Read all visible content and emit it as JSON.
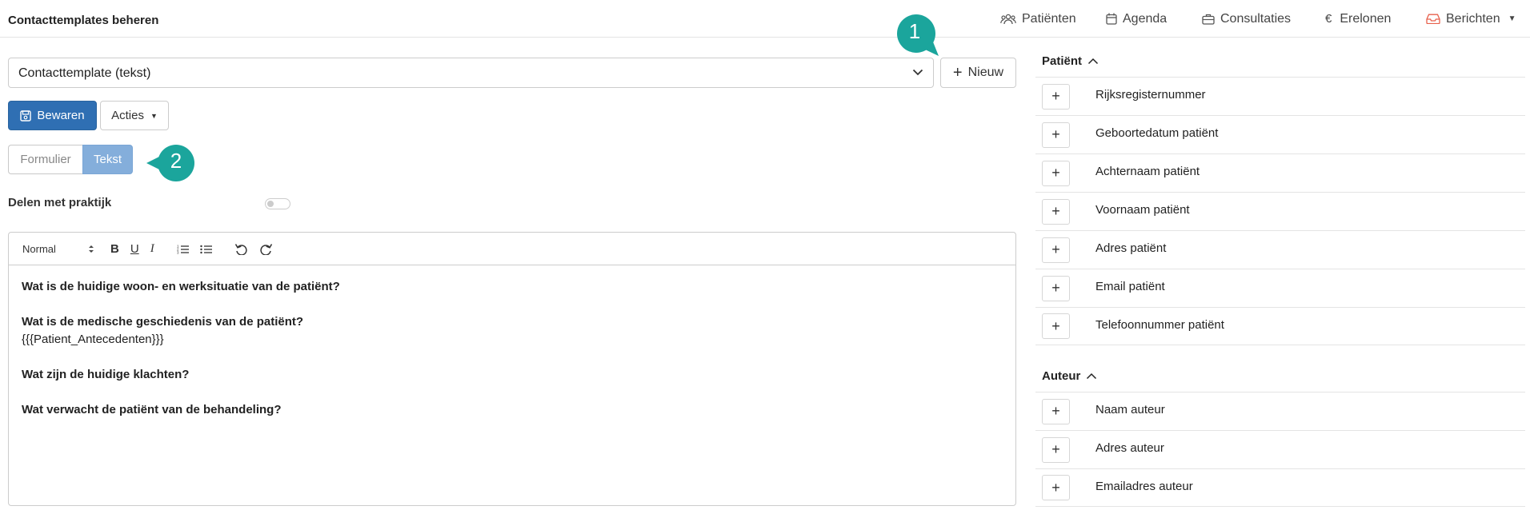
{
  "header": {
    "title": "Contacttemplates beheren",
    "nav": [
      {
        "label": "Patiënten",
        "icon": "users-icon"
      },
      {
        "label": "Agenda",
        "icon": "calendar-icon"
      },
      {
        "label": "Consultaties",
        "icon": "briefcase-icon"
      },
      {
        "label": "Erelonen",
        "icon": "euro-icon"
      },
      {
        "label": "Berichten",
        "icon": "inbox-icon",
        "accent": "#e8604c"
      }
    ]
  },
  "template_select": {
    "value": "Contacttemplate (tekst)"
  },
  "buttons": {
    "new_label": "Nieuw",
    "save_label": "Bewaren",
    "actions_label": "Acties"
  },
  "mode_toggle": {
    "form_label": "Formulier",
    "text_label": "Tekst",
    "active": "Tekst"
  },
  "share": {
    "label": "Delen met praktijk",
    "enabled": false
  },
  "editor": {
    "format_select": "Normal",
    "toolbar_icons": [
      "bold-icon",
      "underline-icon",
      "italic-icon",
      "ordered-list-icon",
      "bullet-list-icon",
      "undo-icon",
      "redo-icon"
    ],
    "bold_label": "B",
    "underline_label": "U",
    "italic_label": "I",
    "lines": [
      "Wat is de huidige woon- en werksituatie van de patiënt?",
      "Wat is de medische geschiedenis van de patiënt?",
      "{{{Patient_Antecedenten}}}",
      "Wat zijn de huidige klachten?",
      "Wat verwacht de patiënt van de behandeling?"
    ]
  },
  "sections": [
    {
      "title": "Patiënt",
      "items": [
        "Rijksregisternummer",
        "Geboortedatum patiënt",
        "Achternaam patiënt",
        "Voornaam patiënt",
        "Adres patiënt",
        "Email patiënt",
        "Telefoonnummer patiënt"
      ]
    },
    {
      "title": "Auteur",
      "items": [
        "Naam auteur",
        "Adres auteur",
        "Emailadres auteur"
      ]
    }
  ],
  "annotations": [
    "1",
    "2"
  ],
  "colors": {
    "primary": "#2f6fb3",
    "toggle_active": "#84aedb",
    "callout": "#1ba59c",
    "berichten": "#e8604c"
  }
}
